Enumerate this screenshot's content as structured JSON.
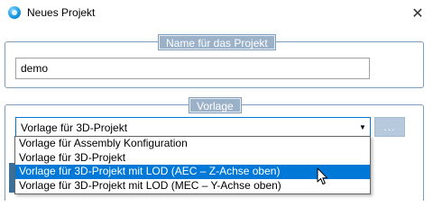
{
  "window": {
    "title": "Neues Projekt",
    "close_label": "✕"
  },
  "name_group": {
    "legend": "Name für das Projekt",
    "value": "demo"
  },
  "template_group": {
    "legend": "Vorlage",
    "selected_value": "Vorlage für 3D-Projekt",
    "browse_label": "...",
    "options": [
      "Vorlage für Assembly Konfiguration",
      "Vorlage für 3D-Projekt",
      "Vorlage für 3D-Projekt mit LOD (AEC – Z-Achse oben)",
      "Vorlage für 3D-Projekt mit LOD (MEC – Y-Achse oben)"
    ],
    "highlighted_option": "Vorlage für 3D-Projekt mit LOD (AEC – Z-Achse oben)"
  },
  "icons": {
    "app": "app-logo-icon",
    "close": "close-icon",
    "dropdown": "chevron-down-icon",
    "cursor": "mouse-pointer-icon"
  },
  "colors": {
    "accent": "#0078d7",
    "group_border": "#7f9db9",
    "legend_bg": "#9bb1c8",
    "browse_bg": "#b7c9dc"
  }
}
